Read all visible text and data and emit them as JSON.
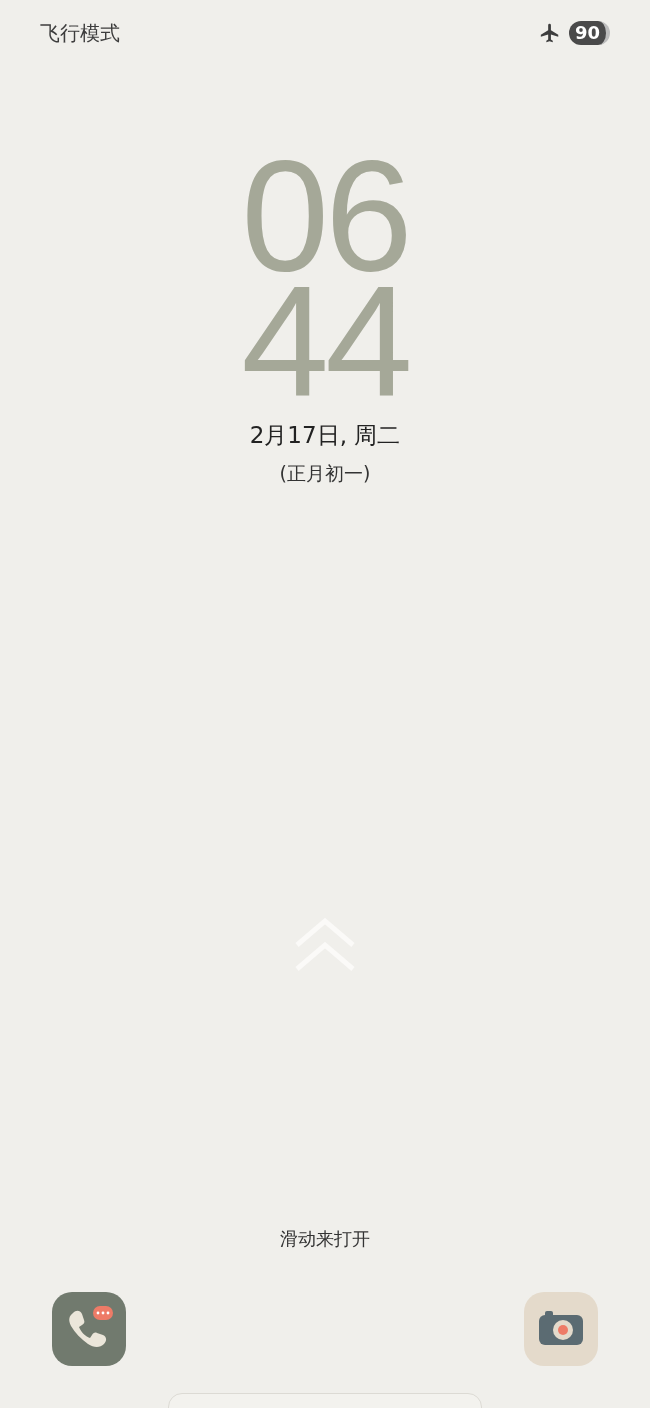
{
  "status_bar": {
    "label": "飞行模式",
    "battery": "90"
  },
  "clock": {
    "hours": "06",
    "minutes": "44"
  },
  "date": "2月17日, 周二",
  "lunar_date": "(正月初一)",
  "unlock_hint": "滑动来打开",
  "shortcuts": [
    {
      "kind": "phone"
    },
    {
      "kind": "camera"
    }
  ]
}
